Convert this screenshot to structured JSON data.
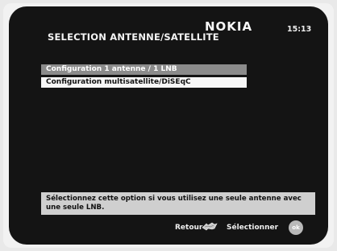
{
  "header": {
    "title": "SELECTION ANTENNE/SATELLITE",
    "brand": "NOKIA",
    "time": "15:13"
  },
  "menu": {
    "items": [
      {
        "label": "Configuration 1 antenne / 1 LNB",
        "selected": true
      },
      {
        "label": "Configuration multisatellite/DiSEqC",
        "selected": false
      }
    ]
  },
  "help": {
    "text": "Sélectionnez cette option si vous utilisez une seule antenne avec une seule LNB."
  },
  "footer": {
    "back_label": "Retour",
    "select_label": "Sélectionner",
    "ok_label": "ok",
    "back_icon": "back-remote-icon",
    "ok_icon": "ok-button-icon"
  }
}
